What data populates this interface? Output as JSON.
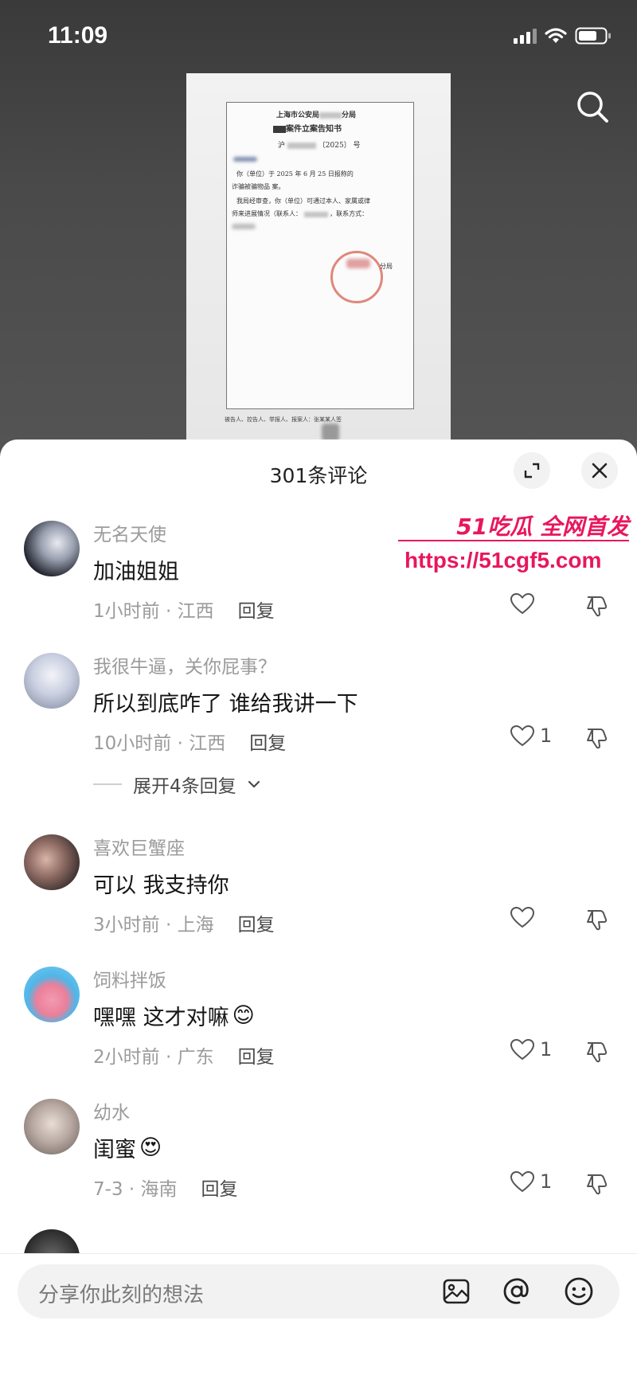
{
  "status_bar": {
    "time": "11:09"
  },
  "document": {
    "header_line1": "上海市公安局",
    "header_line1_suffix": "分局",
    "header_line2": "案件立案告知书",
    "ref_prefix": "沪",
    "ref_year": "〔2025〕",
    "ref_suffix": "号",
    "body_line1": "你（单位）于 2025 年 6 月 25 日报称的",
    "body_line2": "诈骗被骗物品 案。",
    "body_line3": "我局经审查，你（单位）可通过本人、家属或律",
    "body_line4": "师来进展情况（联系人：",
    "body_line4b": "，联系方式：",
    "seal_text": "分局",
    "footer": "被告人、控告人、举报人、报案人：张某某人签"
  },
  "comments_header": {
    "title": "301条评论"
  },
  "comments": [
    {
      "name": "无名天使",
      "text": "加油姐姐",
      "emoji": "",
      "time": "1小时前 · 江西",
      "reply": "回复",
      "likes": "",
      "avatar_color": "#2e3440"
    },
    {
      "name": "我很牛逼，关你屁事？",
      "text": "所以到底咋了 谁给我讲一下",
      "emoji": "",
      "time": "10小时前 · 江西",
      "reply": "回复",
      "likes": "1",
      "avatar_color": "#c9cfe0",
      "expand": "展开4条回复"
    },
    {
      "name": "喜欢巨蟹座",
      "text": "可以 我支持你",
      "emoji": "",
      "time": "3小时前 · 上海",
      "reply": "回复",
      "likes": "",
      "avatar_color": "#4a3a38"
    },
    {
      "name": "饲料拌饭",
      "text": "嘿嘿 这才对嘛",
      "emoji": "😊",
      "time": "2小时前 · 广东",
      "reply": "回复",
      "likes": "1",
      "avatar_color": "#4fb6e8"
    },
    {
      "name": "幼水",
      "text": "闺蜜",
      "emoji": "😍",
      "time": "7-3 · 海南",
      "reply": "回复",
      "likes": "1",
      "avatar_color": "#b9aaa3"
    }
  ],
  "watermark": {
    "top": "51吃瓜 全网首发",
    "url": "https://51cgf5.com"
  },
  "input": {
    "placeholder": "分享你此刻的想法"
  },
  "colors": {
    "accent_watermark": "#e8175d",
    "sheet_bg": "#ffffff",
    "meta_gray": "#9b9b9b"
  },
  "icons": {
    "search": "search-icon",
    "expand": "expand-icon",
    "close": "close-icon",
    "like": "heart-icon",
    "dislike": "thumbs-down-icon",
    "image": "image-icon",
    "mention": "at-icon",
    "emoji": "smiley-icon"
  }
}
